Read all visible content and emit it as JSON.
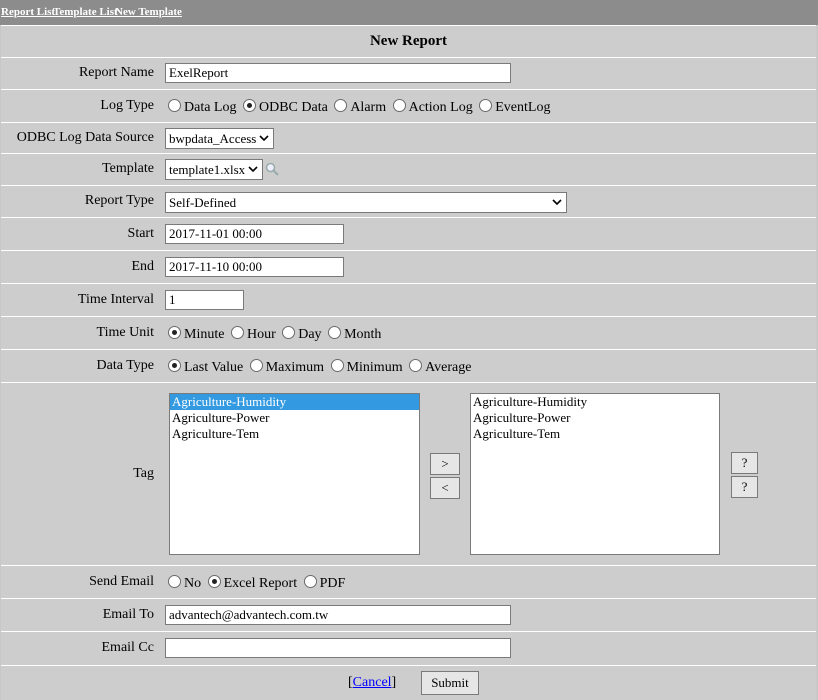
{
  "nav": {
    "report_list": "Report List",
    "template_list": "Template List",
    "new_template": "New Template"
  },
  "header": {
    "title": "New Report"
  },
  "form": {
    "report_name": {
      "label": "Report Name",
      "value": "ExelReport"
    },
    "log_type": {
      "label": "Log Type",
      "options": [
        "Data Log",
        "ODBC Data",
        "Alarm",
        "Action Log",
        "EventLog"
      ],
      "selected": "ODBC Data"
    },
    "odbc_source": {
      "label": "ODBC Log Data Source",
      "value": "bwpdata_Access"
    },
    "template": {
      "label": "Template",
      "value": "template1.xlsx"
    },
    "report_type": {
      "label": "Report Type",
      "value": "Self-Defined"
    },
    "start": {
      "label": "Start",
      "value": "2017-11-01 00:00"
    },
    "end": {
      "label": "End",
      "value": "2017-11-10 00:00"
    },
    "time_interval": {
      "label": "Time Interval",
      "value": "1"
    },
    "time_unit": {
      "label": "Time Unit",
      "options": [
        "Minute",
        "Hour",
        "Day",
        "Month"
      ],
      "selected": "Minute"
    },
    "data_type": {
      "label": "Data Type",
      "options": [
        "Last Value",
        "Maximum",
        "Minimum",
        "Average"
      ],
      "selected": "Last Value"
    },
    "tag": {
      "label": "Tag",
      "available": [
        "Agriculture-Humidity",
        "Agriculture-Power",
        "Agriculture-Tem"
      ],
      "selected_available": "Agriculture-Humidity",
      "chosen": [
        "Agriculture-Humidity",
        "Agriculture-Power",
        "Agriculture-Tem"
      ],
      "add_label": ">",
      "remove_label": "<",
      "up_label": "?",
      "down_label": "?"
    },
    "send_email": {
      "label": "Send Email",
      "options": [
        "No",
        "Excel Report",
        "PDF"
      ],
      "selected": "Excel Report"
    },
    "email_to": {
      "label": "Email To",
      "value": "advantech@advantech.com.tw"
    },
    "email_cc": {
      "label": "Email Cc",
      "value": ""
    }
  },
  "actions": {
    "cancel_prefix": "[",
    "cancel": "Cancel",
    "cancel_suffix": "]",
    "submit": "Submit"
  }
}
